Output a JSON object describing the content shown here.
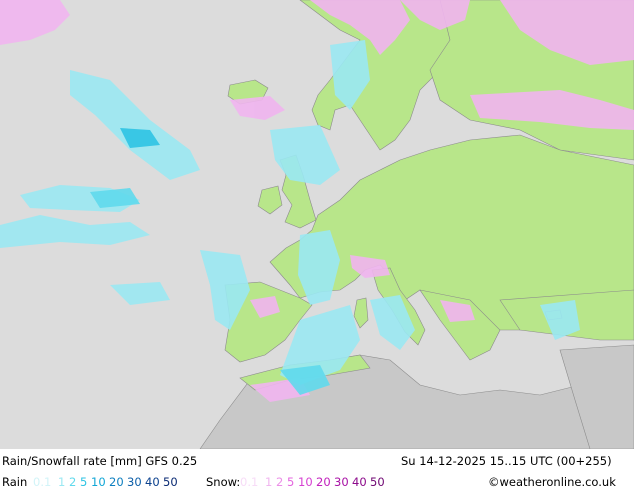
{
  "title": "Rain/Snowfall rate [mm] GFS 0.25",
  "valid_time": "Su 14-12-2025 15..15 UTC (00+255)",
  "legend": {
    "rain_label": "Rain",
    "rain_levels": [
      {
        "label": "0.1",
        "color": "#d2f4f8"
      },
      {
        "label": "1",
        "color": "#9ae8f2"
      },
      {
        "label": "2",
        "color": "#5fd9ec"
      },
      {
        "label": "5",
        "color": "#2dc3e3"
      },
      {
        "label": "10",
        "color": "#10a6d6"
      },
      {
        "label": "20",
        "color": "#0d7fc0"
      },
      {
        "label": "30",
        "color": "#0c5ea8"
      },
      {
        "label": "40",
        "color": "#0b418e"
      },
      {
        "label": "50",
        "color": "#0a2a73"
      }
    ],
    "snow_label": "Snow:",
    "snow_levels": [
      {
        "label": "0.1",
        "color": "#f7dcf7"
      },
      {
        "label": "1",
        "color": "#f1b5ef"
      },
      {
        "label": "2",
        "color": "#ec8fe8"
      },
      {
        "label": "5",
        "color": "#e466df"
      },
      {
        "label": "10",
        "color": "#d63fd1"
      },
      {
        "label": "20",
        "color": "#c221bd"
      },
      {
        "label": "30",
        "color": "#a811a5"
      },
      {
        "label": "40",
        "color": "#8c0a8b"
      },
      {
        "label": "50",
        "color": "#6e0672"
      }
    ]
  },
  "credit": "©weatheronline.co.uk",
  "colors": {
    "sea": "#dcdcdc",
    "land": "#b8e68a",
    "land_dry": "#c8c8c8",
    "border": "#8c8c8c"
  }
}
